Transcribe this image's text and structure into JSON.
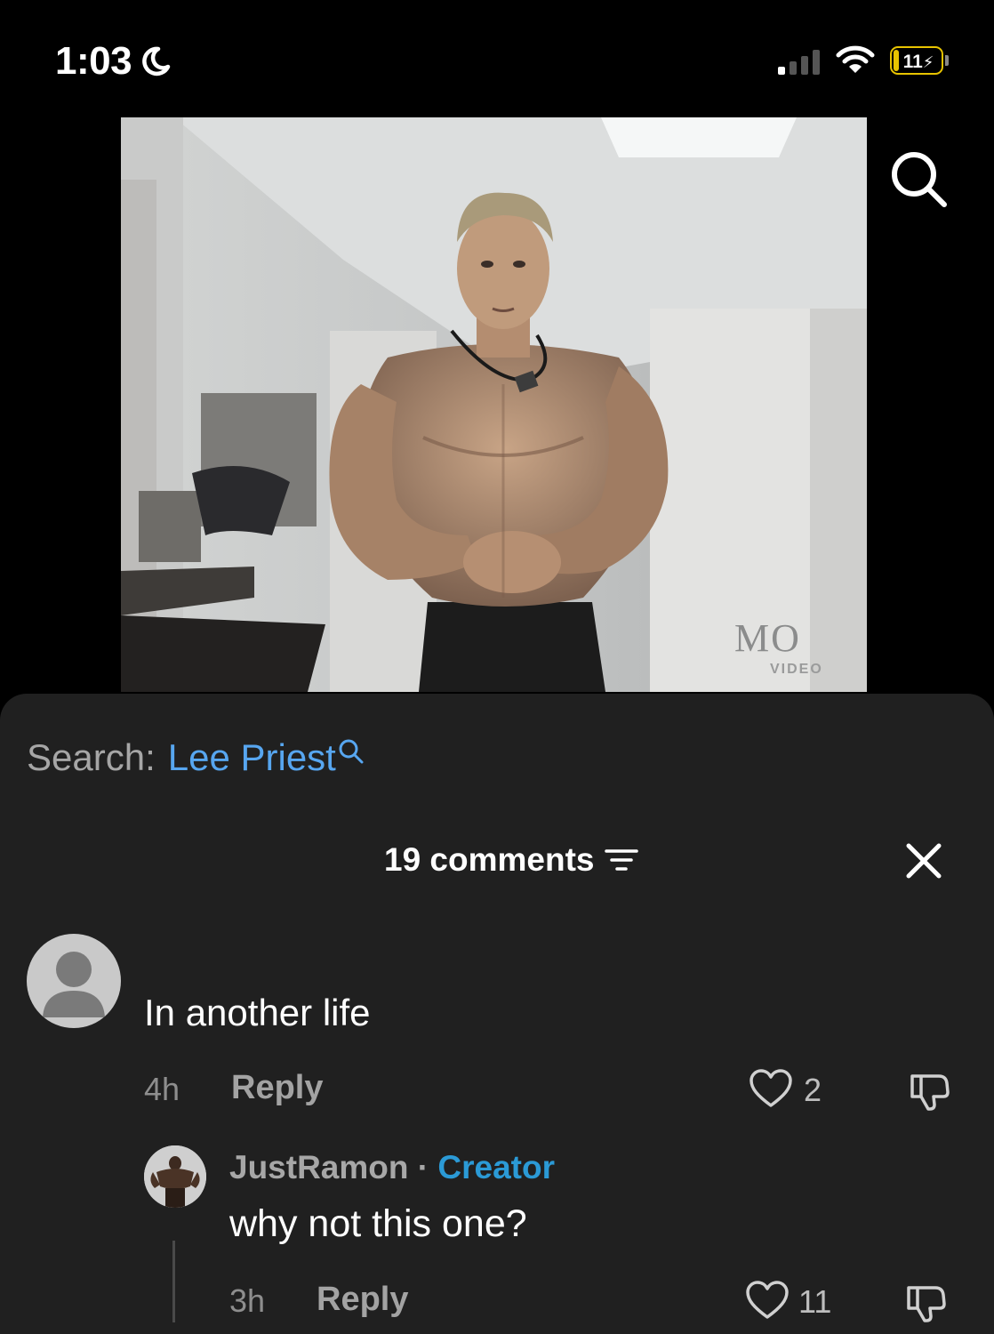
{
  "status_bar": {
    "time": "1:03",
    "battery": "11",
    "battery_level": 0.11
  },
  "video": {
    "watermark_main": "MO",
    "watermark_sub": "VIDEO"
  },
  "search": {
    "prefix": "Search:",
    "term": "Lee Priest"
  },
  "comments_header": {
    "count_label": "19 comments"
  },
  "comments": [
    {
      "text": "In another life",
      "time": "4h",
      "reply_label": "Reply",
      "likes": "2"
    }
  ],
  "replies": [
    {
      "author": "JustRamon",
      "separator": " · ",
      "badge": "Creator",
      "text": "why not this one?",
      "time": "3h",
      "reply_label": "Reply",
      "likes": "11"
    }
  ],
  "colors": {
    "accent_link": "#57a6f0",
    "creator_badge": "#2b9ad6",
    "battery_low": "#e8c400",
    "sheet_bg": "#202020"
  }
}
